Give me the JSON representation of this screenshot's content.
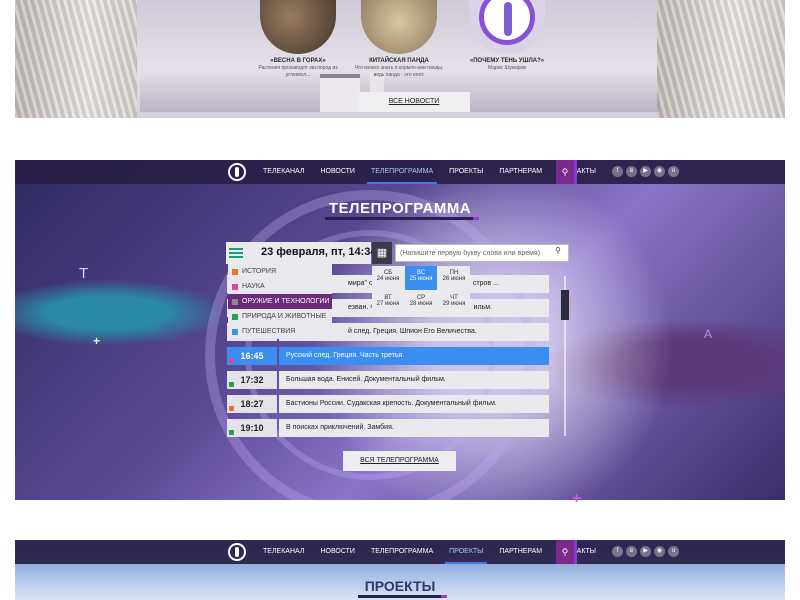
{
  "news": {
    "items": [
      {
        "title": "«ВЕСНА В ГОРАХ»",
        "desc": "Растения производят кислород из углекисл..."
      },
      {
        "title": "КИТАЙСКАЯ ПАНДА",
        "desc": "Что можно знать о кормле-нии панды, ведь панда - это енот."
      },
      {
        "title": "«ПОЧЕМУ ТЕНЬ УШЛА?»",
        "desc": "Марис Шумаров"
      }
    ],
    "all_news_label": "ВСЕ НОВОСТИ"
  },
  "nav": {
    "items": [
      "ТЕЛЕКАНАЛ",
      "НОВОСТИ",
      "ТЕЛЕПРОГРАММА",
      "ПРОЕКТЫ",
      "ПАРТНЕРАМ",
      "КОНТАКТЫ"
    ],
    "social_icons": [
      "facebook-icon",
      "vk-icon",
      "youtube-icon",
      "instagram-icon",
      "odnoklassniki-icon"
    ]
  },
  "tv": {
    "title": "ТЕЛЕПРОГРАММА",
    "date": "23 февраля, пт, 14:34",
    "search_placeholder": "(Напишите первую букву слова или время)",
    "categories": [
      {
        "label": "ИСТОРИЯ",
        "color": "#e07a2a"
      },
      {
        "label": "НАУКА",
        "color": "#d64aa0"
      },
      {
        "label": "ОРУЖИЕ И ТЕХНОЛОГИИ",
        "color": "#8a8a8a"
      },
      {
        "label": "ПРИРОДА И ЖИВОТНЫЕ",
        "color": "#2aa04a"
      },
      {
        "label": "ПУТЕШЕСТВИЯ",
        "color": "#3a9ad8"
      }
    ],
    "active_category": 2,
    "days": [
      {
        "dow": "СБ",
        "date": "24 июня"
      },
      {
        "dow": "ВС",
        "date": "25 июня"
      },
      {
        "dow": "ПН",
        "date": "26 июня"
      },
      {
        "dow": "ВТ",
        "date": "27 июня"
      },
      {
        "dow": "СР",
        "date": "28 июня"
      },
      {
        "dow": "ЧТ",
        "date": "29 июня"
      }
    ],
    "active_day": 1,
    "schedule": [
      {
        "time": "",
        "title": "мира\" с Ан",
        "title_end": "стров ...",
        "mark": ""
      },
      {
        "time": "",
        "title": "езван. Фил",
        "title_end": "ильм.",
        "mark": ""
      },
      {
        "time": "",
        "title": "й след. Греция. Шпион Его Величества.",
        "title_end": "",
        "mark": ""
      },
      {
        "time": "16:45",
        "title": "Русский след. Греция. Часть третья.",
        "title_end": "",
        "mark": "#d64aa0"
      },
      {
        "time": "17:32",
        "title": "Большая вода. Енисей. Документальный фильм.",
        "title_end": "",
        "mark": "#2aa04a"
      },
      {
        "time": "18:27",
        "title": "Бастионы России. Судакская крепость. Документальный фильм.",
        "title_end": "",
        "mark": "#e07a2a"
      },
      {
        "time": "19:10",
        "title": "В поисках приключений. Замбия.",
        "title_end": "",
        "mark": "#2aa04a"
      }
    ],
    "highlighted_row": 3,
    "all_tv_label": "ВСЯ ТЕЛЕПРОГРАММА",
    "deco_t": "T",
    "deco_a": "A"
  },
  "projects": {
    "title": "ПРОЕКТЫ",
    "active_nav": 3
  },
  "colors": {
    "accent_blue": "#3a8ef0",
    "accent_purple": "#a03ad0",
    "nav_bg": "#281e46"
  }
}
